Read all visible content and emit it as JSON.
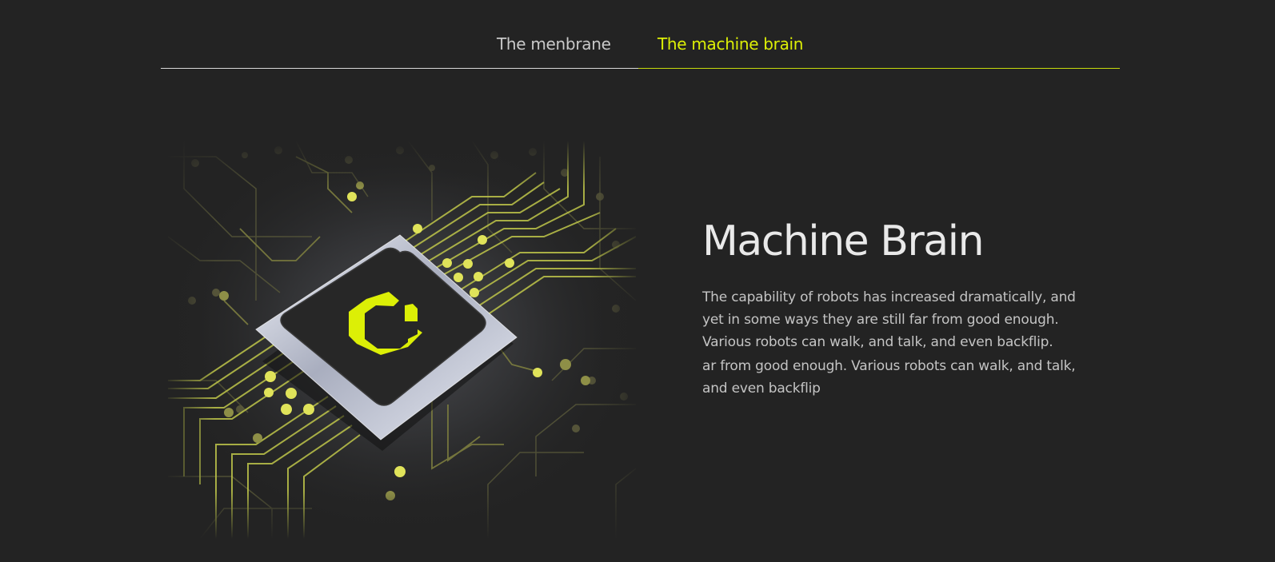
{
  "tabs": {
    "items": [
      {
        "label": "The menbrane",
        "active": false
      },
      {
        "label": "The machine brain",
        "active": true
      }
    ]
  },
  "main": {
    "title": "Machine Brain",
    "paragraphs": [
      "The capability of robots has increased dramatically, and yet in some ways they are still  far from good enough. Various robots can walk, and talk, and even backflip.",
      "ar from good enough.  Various robots can walk, and talk, and even backflip"
    ]
  },
  "colors": {
    "background": "#232323",
    "accent": "#dcef06",
    "tab_inactive": "#c9c9c9",
    "heading": "#e9e9e9",
    "body_text": "#c4c4c4"
  },
  "illustration": {
    "icon": "chip-circuit-illustration"
  }
}
